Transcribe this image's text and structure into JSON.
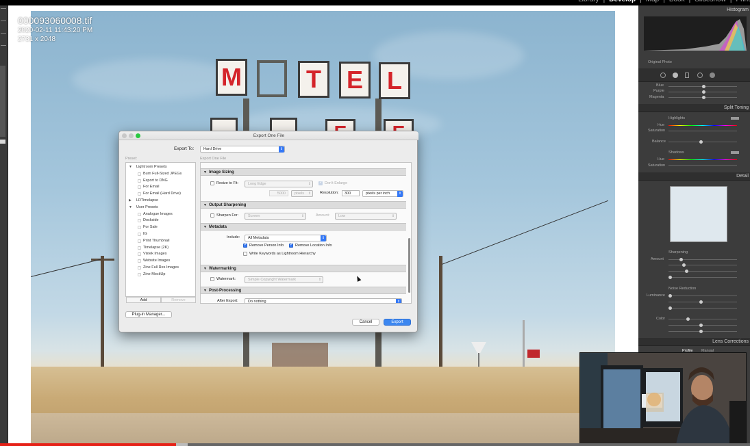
{
  "top_nav": {
    "modules": [
      "Library",
      "Develop",
      "Map",
      "Book",
      "Slideshow",
      "Print"
    ],
    "active": "Develop"
  },
  "overlay": {
    "filename": "000093060008.tif",
    "datetime": "2020-02-11 11:43:20 PM",
    "dimensions": "2731 x 2048"
  },
  "photo": {
    "sign_letters": [
      "M",
      "",
      "T",
      "E",
      "L"
    ],
    "lower_letters": [
      "E",
      "E"
    ]
  },
  "right_panel": {
    "histogram_label": "Histogram",
    "original_photo": "Original Photo",
    "hsl_labels": [
      "Blue",
      "Purple",
      "Magenta"
    ],
    "split_toning": {
      "title": "Split Toning",
      "highlights": "Highlights",
      "hue": "Hue",
      "saturation": "Saturation",
      "balance": "Balance",
      "shadows": "Shadows"
    },
    "detail": {
      "title": "Detail",
      "sharpening": "Sharpening",
      "amount": "Amount",
      "noise_reduction": "Noise Reduction",
      "luminance": "Luminance",
      "color": "Color"
    },
    "lens_corrections": {
      "title": "Lens Corrections",
      "tabs": [
        "Profile",
        "Manual"
      ]
    }
  },
  "dialog": {
    "title": "Export One File",
    "export_to_label": "Export To:",
    "export_to_value": "Hard Drive",
    "preset_label": "Preset:",
    "settings_label": "Export One File",
    "preset_groups": [
      {
        "name": "Lightroom Presets",
        "expanded": true,
        "items": [
          "Burn Full-Sized JPEGs",
          "Export to DNG",
          "For Email",
          "For Email (Hard Drive)"
        ]
      },
      {
        "name": "LRTimelapse",
        "expanded": false,
        "items": []
      },
      {
        "name": "User Presets",
        "expanded": true,
        "items": [
          "Analogue Images",
          "Dockside",
          "For Sale",
          "IG",
          "Print Thumbnail",
          "Timelapse (2K)",
          "Vistek Images",
          "Website Images",
          "Zine Full Res Images",
          "Zine MockUp"
        ]
      }
    ],
    "add_button": "Add",
    "remove_button": "Remove",
    "plugin_manager": "Plug-in Manager...",
    "sections": {
      "image_sizing": {
        "title": "Image Sizing",
        "resize_to_fit": "Resize to Fit:",
        "resize_mode": "Long Edge",
        "dont_enlarge": "Don't Enlarge",
        "size_value": "5000",
        "size_unit": "pixels",
        "resolution_label": "Resolution:",
        "resolution_value": "300",
        "resolution_unit": "pixels per inch"
      },
      "output_sharpening": {
        "title": "Output Sharpening",
        "sharpen_for": "Sharpen For:",
        "sharpen_value": "Screen",
        "amount_label": "Amount:",
        "amount_value": "Low"
      },
      "metadata": {
        "title": "Metadata",
        "include_label": "Include:",
        "include_value": "All Metadata",
        "remove_person": "Remove Person Info",
        "remove_location": "Remove Location Info",
        "write_keywords": "Write Keywords as Lightroom Hierarchy"
      },
      "watermarking": {
        "title": "Watermarking",
        "watermark_label": "Watermark:",
        "watermark_value": "Simple Copyright Watermark"
      },
      "post_processing": {
        "title": "Post-Processing",
        "after_export_label": "After Export:",
        "after_export_value": "Do nothing"
      }
    },
    "cancel": "Cancel",
    "export": "Export"
  },
  "video_progress": {
    "played_fraction": 0.235,
    "buffered_fraction": 0.25
  }
}
